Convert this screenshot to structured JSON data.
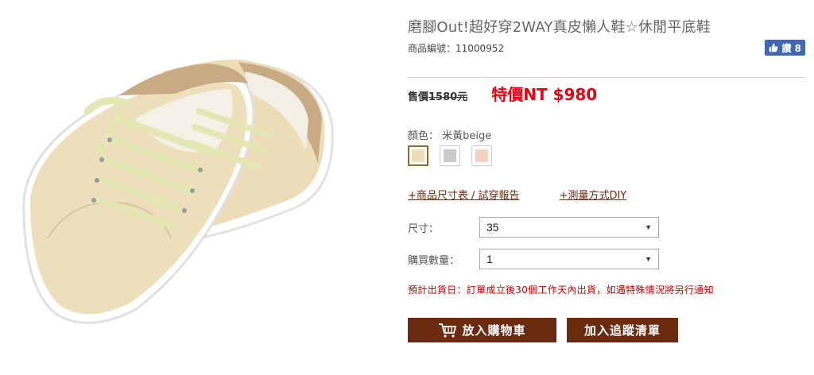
{
  "product": {
    "title": "磨腳Out!超好穿2WAY真皮懶人鞋☆休閒平底鞋",
    "sku_label": "商品編號：",
    "sku": "11000952"
  },
  "like": {
    "icon": "thumbs-up-icon",
    "label": "讚 8",
    "color": "#4267b2"
  },
  "price": {
    "original_label": "售價",
    "original_value": "1580元",
    "sale": "特價NT $980",
    "sale_color": "#e60012"
  },
  "color": {
    "label": "顏色：",
    "selected_name": "米黃beige",
    "swatches": [
      {
        "name": "beige",
        "hex": "#ecdcb7",
        "selected": true
      },
      {
        "name": "gray",
        "hex": "#c9c9c9",
        "selected": false
      },
      {
        "name": "pink",
        "hex": "#f4cfc8",
        "selected": false
      }
    ]
  },
  "links": {
    "size_chart": "+商品尺寸表 / 試穿報告",
    "measure": "+測量方式DIY"
  },
  "size": {
    "label": "尺寸：",
    "value": "35"
  },
  "quantity": {
    "label": "購買數量：",
    "value": "1"
  },
  "shipping_note": "預計出貨日：訂單成立後30個工作天內出貨，如遇特殊情況將另行通知",
  "buttons": {
    "cart": "放入購物車",
    "cart_icon": "shopping-cart-icon",
    "track": "加入追蹤清單",
    "color": "#6b2b10"
  }
}
